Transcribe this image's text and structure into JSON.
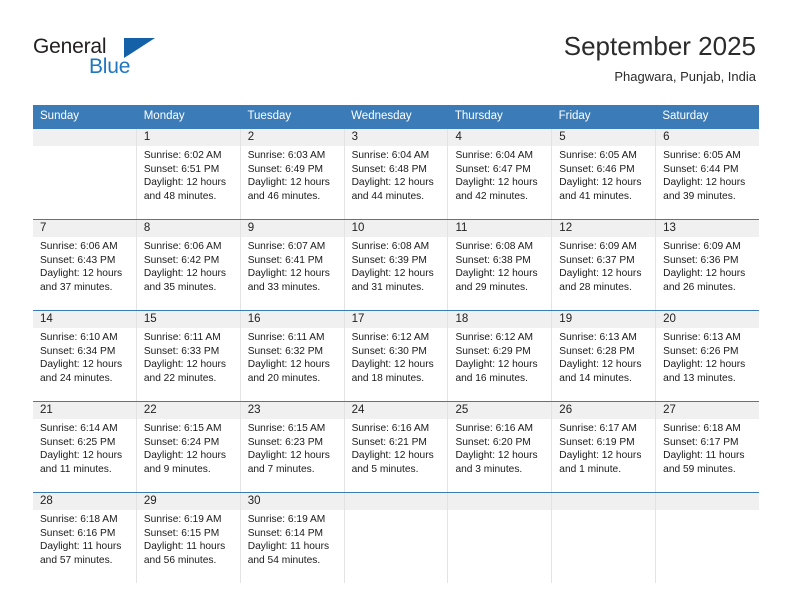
{
  "brand": {
    "name_part1": "General",
    "name_part2": "Blue",
    "accent_color": "#1461a8",
    "blue_text_color": "#1f77c2",
    "triangle_icon": "triangle-icon"
  },
  "header": {
    "title": "September 2025",
    "subtitle": "Phagwara, Punjab, India"
  },
  "calendar": {
    "header_bg": "#3b7cb8",
    "day_band_bg": "#f0f0f0",
    "weekdays": [
      "Sunday",
      "Monday",
      "Tuesday",
      "Wednesday",
      "Thursday",
      "Friday",
      "Saturday"
    ],
    "weeks": [
      [
        {
          "day": "",
          "sunrise": "",
          "sunset": "",
          "daylight_line1": "",
          "daylight_line2": ""
        },
        {
          "day": "1",
          "sunrise": "Sunrise: 6:02 AM",
          "sunset": "Sunset: 6:51 PM",
          "daylight_line1": "Daylight: 12 hours",
          "daylight_line2": "and 48 minutes."
        },
        {
          "day": "2",
          "sunrise": "Sunrise: 6:03 AM",
          "sunset": "Sunset: 6:49 PM",
          "daylight_line1": "Daylight: 12 hours",
          "daylight_line2": "and 46 minutes."
        },
        {
          "day": "3",
          "sunrise": "Sunrise: 6:04 AM",
          "sunset": "Sunset: 6:48 PM",
          "daylight_line1": "Daylight: 12 hours",
          "daylight_line2": "and 44 minutes."
        },
        {
          "day": "4",
          "sunrise": "Sunrise: 6:04 AM",
          "sunset": "Sunset: 6:47 PM",
          "daylight_line1": "Daylight: 12 hours",
          "daylight_line2": "and 42 minutes."
        },
        {
          "day": "5",
          "sunrise": "Sunrise: 6:05 AM",
          "sunset": "Sunset: 6:46 PM",
          "daylight_line1": "Daylight: 12 hours",
          "daylight_line2": "and 41 minutes."
        },
        {
          "day": "6",
          "sunrise": "Sunrise: 6:05 AM",
          "sunset": "Sunset: 6:44 PM",
          "daylight_line1": "Daylight: 12 hours",
          "daylight_line2": "and 39 minutes."
        }
      ],
      [
        {
          "day": "7",
          "sunrise": "Sunrise: 6:06 AM",
          "sunset": "Sunset: 6:43 PM",
          "daylight_line1": "Daylight: 12 hours",
          "daylight_line2": "and 37 minutes."
        },
        {
          "day": "8",
          "sunrise": "Sunrise: 6:06 AM",
          "sunset": "Sunset: 6:42 PM",
          "daylight_line1": "Daylight: 12 hours",
          "daylight_line2": "and 35 minutes."
        },
        {
          "day": "9",
          "sunrise": "Sunrise: 6:07 AM",
          "sunset": "Sunset: 6:41 PM",
          "daylight_line1": "Daylight: 12 hours",
          "daylight_line2": "and 33 minutes."
        },
        {
          "day": "10",
          "sunrise": "Sunrise: 6:08 AM",
          "sunset": "Sunset: 6:39 PM",
          "daylight_line1": "Daylight: 12 hours",
          "daylight_line2": "and 31 minutes."
        },
        {
          "day": "11",
          "sunrise": "Sunrise: 6:08 AM",
          "sunset": "Sunset: 6:38 PM",
          "daylight_line1": "Daylight: 12 hours",
          "daylight_line2": "and 29 minutes."
        },
        {
          "day": "12",
          "sunrise": "Sunrise: 6:09 AM",
          "sunset": "Sunset: 6:37 PM",
          "daylight_line1": "Daylight: 12 hours",
          "daylight_line2": "and 28 minutes."
        },
        {
          "day": "13",
          "sunrise": "Sunrise: 6:09 AM",
          "sunset": "Sunset: 6:36 PM",
          "daylight_line1": "Daylight: 12 hours",
          "daylight_line2": "and 26 minutes."
        }
      ],
      [
        {
          "day": "14",
          "sunrise": "Sunrise: 6:10 AM",
          "sunset": "Sunset: 6:34 PM",
          "daylight_line1": "Daylight: 12 hours",
          "daylight_line2": "and 24 minutes."
        },
        {
          "day": "15",
          "sunrise": "Sunrise: 6:11 AM",
          "sunset": "Sunset: 6:33 PM",
          "daylight_line1": "Daylight: 12 hours",
          "daylight_line2": "and 22 minutes."
        },
        {
          "day": "16",
          "sunrise": "Sunrise: 6:11 AM",
          "sunset": "Sunset: 6:32 PM",
          "daylight_line1": "Daylight: 12 hours",
          "daylight_line2": "and 20 minutes."
        },
        {
          "day": "17",
          "sunrise": "Sunrise: 6:12 AM",
          "sunset": "Sunset: 6:30 PM",
          "daylight_line1": "Daylight: 12 hours",
          "daylight_line2": "and 18 minutes."
        },
        {
          "day": "18",
          "sunrise": "Sunrise: 6:12 AM",
          "sunset": "Sunset: 6:29 PM",
          "daylight_line1": "Daylight: 12 hours",
          "daylight_line2": "and 16 minutes."
        },
        {
          "day": "19",
          "sunrise": "Sunrise: 6:13 AM",
          "sunset": "Sunset: 6:28 PM",
          "daylight_line1": "Daylight: 12 hours",
          "daylight_line2": "and 14 minutes."
        },
        {
          "day": "20",
          "sunrise": "Sunrise: 6:13 AM",
          "sunset": "Sunset: 6:26 PM",
          "daylight_line1": "Daylight: 12 hours",
          "daylight_line2": "and 13 minutes."
        }
      ],
      [
        {
          "day": "21",
          "sunrise": "Sunrise: 6:14 AM",
          "sunset": "Sunset: 6:25 PM",
          "daylight_line1": "Daylight: 12 hours",
          "daylight_line2": "and 11 minutes."
        },
        {
          "day": "22",
          "sunrise": "Sunrise: 6:15 AM",
          "sunset": "Sunset: 6:24 PM",
          "daylight_line1": "Daylight: 12 hours",
          "daylight_line2": "and 9 minutes."
        },
        {
          "day": "23",
          "sunrise": "Sunrise: 6:15 AM",
          "sunset": "Sunset: 6:23 PM",
          "daylight_line1": "Daylight: 12 hours",
          "daylight_line2": "and 7 minutes."
        },
        {
          "day": "24",
          "sunrise": "Sunrise: 6:16 AM",
          "sunset": "Sunset: 6:21 PM",
          "daylight_line1": "Daylight: 12 hours",
          "daylight_line2": "and 5 minutes."
        },
        {
          "day": "25",
          "sunrise": "Sunrise: 6:16 AM",
          "sunset": "Sunset: 6:20 PM",
          "daylight_line1": "Daylight: 12 hours",
          "daylight_line2": "and 3 minutes."
        },
        {
          "day": "26",
          "sunrise": "Sunrise: 6:17 AM",
          "sunset": "Sunset: 6:19 PM",
          "daylight_line1": "Daylight: 12 hours",
          "daylight_line2": "and 1 minute."
        },
        {
          "day": "27",
          "sunrise": "Sunrise: 6:18 AM",
          "sunset": "Sunset: 6:17 PM",
          "daylight_line1": "Daylight: 11 hours",
          "daylight_line2": "and 59 minutes."
        }
      ],
      [
        {
          "day": "28",
          "sunrise": "Sunrise: 6:18 AM",
          "sunset": "Sunset: 6:16 PM",
          "daylight_line1": "Daylight: 11 hours",
          "daylight_line2": "and 57 minutes."
        },
        {
          "day": "29",
          "sunrise": "Sunrise: 6:19 AM",
          "sunset": "Sunset: 6:15 PM",
          "daylight_line1": "Daylight: 11 hours",
          "daylight_line2": "and 56 minutes."
        },
        {
          "day": "30",
          "sunrise": "Sunrise: 6:19 AM",
          "sunset": "Sunset: 6:14 PM",
          "daylight_line1": "Daylight: 11 hours",
          "daylight_line2": "and 54 minutes."
        },
        {
          "day": "",
          "sunrise": "",
          "sunset": "",
          "daylight_line1": "",
          "daylight_line2": ""
        },
        {
          "day": "",
          "sunrise": "",
          "sunset": "",
          "daylight_line1": "",
          "daylight_line2": ""
        },
        {
          "day": "",
          "sunrise": "",
          "sunset": "",
          "daylight_line1": "",
          "daylight_line2": ""
        },
        {
          "day": "",
          "sunrise": "",
          "sunset": "",
          "daylight_line1": "",
          "daylight_line2": ""
        }
      ]
    ]
  }
}
